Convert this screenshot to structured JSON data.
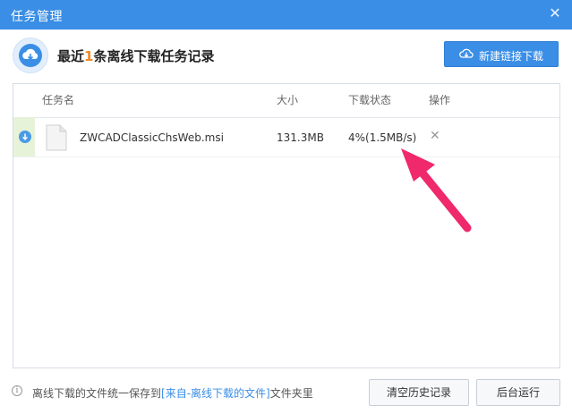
{
  "window": {
    "title": "任务管理",
    "close_glyph": "✕"
  },
  "header": {
    "prefix": "最近",
    "count": "1",
    "suffix": "条离线下载任务记录",
    "icon": "cloud-download-icon"
  },
  "new_button": {
    "label": "新建链接下载",
    "icon": "cloud-download-icon"
  },
  "table": {
    "columns": {
      "name": "任务名",
      "size": "大小",
      "status": "下载状态",
      "action": "操作"
    },
    "rows": [
      {
        "name": "ZWCADClassicChsWeb.msi",
        "size": "131.3MB",
        "status": "4%(1.5MB/s)",
        "delete_glyph": "✕",
        "progress": 0.04
      }
    ]
  },
  "footer": {
    "info_glyph": "i",
    "text_before": "离线下载的文件统一保存到",
    "link": "[来自-离线下载的文件]",
    "text_after": "文件夹里",
    "clear_label": "清空历史记录",
    "background_label": "后台运行"
  },
  "colors": {
    "accent": "#3a8ee6",
    "count": "#f08a22",
    "annotation_arrow": "#f0286c"
  }
}
